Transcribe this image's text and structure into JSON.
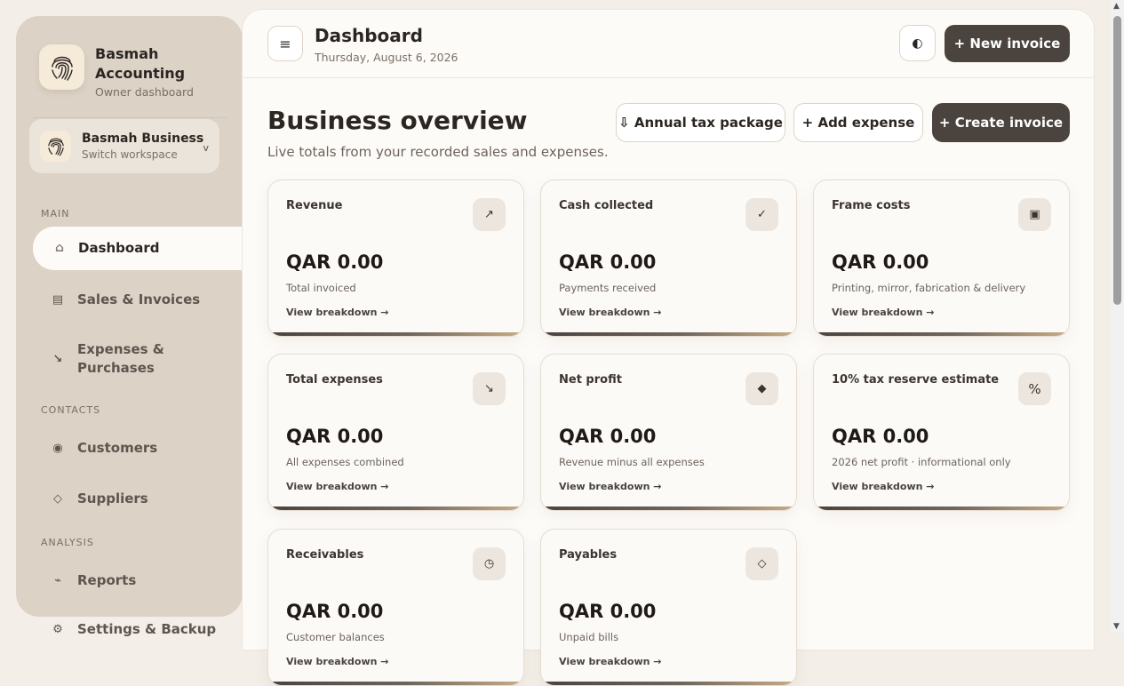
{
  "sidebar": {
    "brand_name": "Basmah Accounting",
    "brand_sub": "Owner dashboard",
    "workspace_name": "Basmah Business",
    "workspace_sub": "Switch workspace",
    "workspace_chevron": "v",
    "sections": {
      "main": "MAIN",
      "contacts": "CONTACTS",
      "analysis": "ANALYSIS"
    },
    "items": [
      {
        "label": "Dashboard",
        "icon": "⌂"
      },
      {
        "label": "Sales & Invoices",
        "icon": "▤"
      },
      {
        "label": "Expenses & Purchases",
        "icon": "↘"
      },
      {
        "label": "Customers",
        "icon": "◉"
      },
      {
        "label": "Suppliers",
        "icon": "◇"
      },
      {
        "label": "Reports",
        "icon": "⌁"
      },
      {
        "label": "Settings & Backup",
        "icon": "⚙"
      }
    ]
  },
  "topbar": {
    "menu_icon": "≡",
    "title": "Dashboard",
    "date": "Thursday, August 6, 2026",
    "theme_icon": "◐",
    "new_invoice": "+  New invoice"
  },
  "overview": {
    "title": "Business overview",
    "subtitle": "Live totals from your recorded sales and expenses.",
    "annual_tax": "⇩ Annual tax package",
    "add_expense": "+  Add expense",
    "create_invoice": "+  Create invoice"
  },
  "cards": [
    {
      "title": "Revenue",
      "icon": "↗",
      "value": "QAR 0.00",
      "desc": "Total invoiced",
      "link": "View breakdown →"
    },
    {
      "title": "Cash collected",
      "icon": "✓",
      "value": "QAR 0.00",
      "desc": "Payments received",
      "link": "View breakdown →"
    },
    {
      "title": "Frame costs",
      "icon": "▣",
      "value": "QAR 0.00",
      "desc": "Printing, mirror, fabrication & delivery",
      "link": "View breakdown →"
    },
    {
      "title": "Total expenses",
      "icon": "↘",
      "value": "QAR 0.00",
      "desc": "All expenses combined",
      "link": "View breakdown →"
    },
    {
      "title": "Net profit",
      "icon": "◆",
      "value": "QAR 0.00",
      "desc": "Revenue minus all expenses",
      "link": "View breakdown →"
    },
    {
      "title": "10% tax reserve estimate",
      "icon": "%",
      "value": "QAR 0.00",
      "desc": "2026 net profit · informational only",
      "link": "View breakdown →"
    },
    {
      "title": "Receivables",
      "icon": "◷",
      "value": "QAR 0.00",
      "desc": "Customer balances",
      "link": "View breakdown →"
    },
    {
      "title": "Payables",
      "icon": "◇",
      "value": "QAR 0.00",
      "desc": "Unpaid bills",
      "link": "View breakdown →"
    }
  ]
}
